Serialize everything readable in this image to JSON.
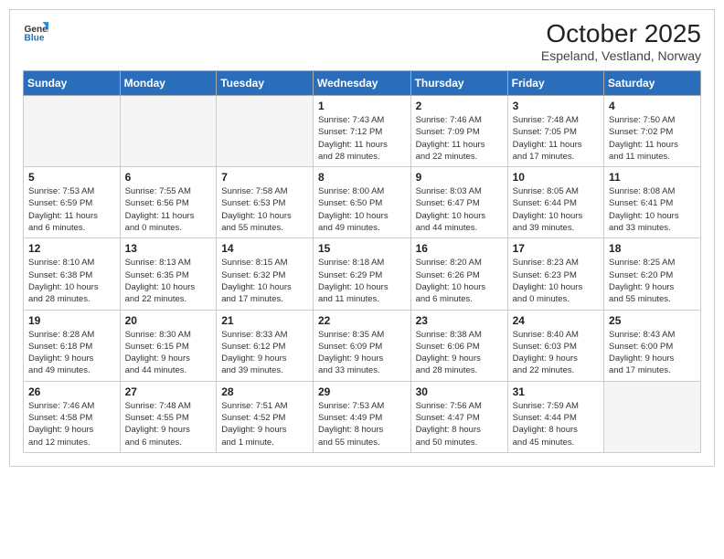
{
  "header": {
    "logo_general": "General",
    "logo_blue": "Blue",
    "title": "October 2025",
    "subtitle": "Espeland, Vestland, Norway"
  },
  "days_of_week": [
    "Sunday",
    "Monday",
    "Tuesday",
    "Wednesday",
    "Thursday",
    "Friday",
    "Saturday"
  ],
  "weeks": [
    [
      {
        "day": "",
        "info": ""
      },
      {
        "day": "",
        "info": ""
      },
      {
        "day": "",
        "info": ""
      },
      {
        "day": "1",
        "info": "Sunrise: 7:43 AM\nSunset: 7:12 PM\nDaylight: 11 hours\nand 28 minutes."
      },
      {
        "day": "2",
        "info": "Sunrise: 7:46 AM\nSunset: 7:09 PM\nDaylight: 11 hours\nand 22 minutes."
      },
      {
        "day": "3",
        "info": "Sunrise: 7:48 AM\nSunset: 7:05 PM\nDaylight: 11 hours\nand 17 minutes."
      },
      {
        "day": "4",
        "info": "Sunrise: 7:50 AM\nSunset: 7:02 PM\nDaylight: 11 hours\nand 11 minutes."
      }
    ],
    [
      {
        "day": "5",
        "info": "Sunrise: 7:53 AM\nSunset: 6:59 PM\nDaylight: 11 hours\nand 6 minutes."
      },
      {
        "day": "6",
        "info": "Sunrise: 7:55 AM\nSunset: 6:56 PM\nDaylight: 11 hours\nand 0 minutes."
      },
      {
        "day": "7",
        "info": "Sunrise: 7:58 AM\nSunset: 6:53 PM\nDaylight: 10 hours\nand 55 minutes."
      },
      {
        "day": "8",
        "info": "Sunrise: 8:00 AM\nSunset: 6:50 PM\nDaylight: 10 hours\nand 49 minutes."
      },
      {
        "day": "9",
        "info": "Sunrise: 8:03 AM\nSunset: 6:47 PM\nDaylight: 10 hours\nand 44 minutes."
      },
      {
        "day": "10",
        "info": "Sunrise: 8:05 AM\nSunset: 6:44 PM\nDaylight: 10 hours\nand 39 minutes."
      },
      {
        "day": "11",
        "info": "Sunrise: 8:08 AM\nSunset: 6:41 PM\nDaylight: 10 hours\nand 33 minutes."
      }
    ],
    [
      {
        "day": "12",
        "info": "Sunrise: 8:10 AM\nSunset: 6:38 PM\nDaylight: 10 hours\nand 28 minutes."
      },
      {
        "day": "13",
        "info": "Sunrise: 8:13 AM\nSunset: 6:35 PM\nDaylight: 10 hours\nand 22 minutes."
      },
      {
        "day": "14",
        "info": "Sunrise: 8:15 AM\nSunset: 6:32 PM\nDaylight: 10 hours\nand 17 minutes."
      },
      {
        "day": "15",
        "info": "Sunrise: 8:18 AM\nSunset: 6:29 PM\nDaylight: 10 hours\nand 11 minutes."
      },
      {
        "day": "16",
        "info": "Sunrise: 8:20 AM\nSunset: 6:26 PM\nDaylight: 10 hours\nand 6 minutes."
      },
      {
        "day": "17",
        "info": "Sunrise: 8:23 AM\nSunset: 6:23 PM\nDaylight: 10 hours\nand 0 minutes."
      },
      {
        "day": "18",
        "info": "Sunrise: 8:25 AM\nSunset: 6:20 PM\nDaylight: 9 hours\nand 55 minutes."
      }
    ],
    [
      {
        "day": "19",
        "info": "Sunrise: 8:28 AM\nSunset: 6:18 PM\nDaylight: 9 hours\nand 49 minutes."
      },
      {
        "day": "20",
        "info": "Sunrise: 8:30 AM\nSunset: 6:15 PM\nDaylight: 9 hours\nand 44 minutes."
      },
      {
        "day": "21",
        "info": "Sunrise: 8:33 AM\nSunset: 6:12 PM\nDaylight: 9 hours\nand 39 minutes."
      },
      {
        "day": "22",
        "info": "Sunrise: 8:35 AM\nSunset: 6:09 PM\nDaylight: 9 hours\nand 33 minutes."
      },
      {
        "day": "23",
        "info": "Sunrise: 8:38 AM\nSunset: 6:06 PM\nDaylight: 9 hours\nand 28 minutes."
      },
      {
        "day": "24",
        "info": "Sunrise: 8:40 AM\nSunset: 6:03 PM\nDaylight: 9 hours\nand 22 minutes."
      },
      {
        "day": "25",
        "info": "Sunrise: 8:43 AM\nSunset: 6:00 PM\nDaylight: 9 hours\nand 17 minutes."
      }
    ],
    [
      {
        "day": "26",
        "info": "Sunrise: 7:46 AM\nSunset: 4:58 PM\nDaylight: 9 hours\nand 12 minutes."
      },
      {
        "day": "27",
        "info": "Sunrise: 7:48 AM\nSunset: 4:55 PM\nDaylight: 9 hours\nand 6 minutes."
      },
      {
        "day": "28",
        "info": "Sunrise: 7:51 AM\nSunset: 4:52 PM\nDaylight: 9 hours\nand 1 minute."
      },
      {
        "day": "29",
        "info": "Sunrise: 7:53 AM\nSunset: 4:49 PM\nDaylight: 8 hours\nand 55 minutes."
      },
      {
        "day": "30",
        "info": "Sunrise: 7:56 AM\nSunset: 4:47 PM\nDaylight: 8 hours\nand 50 minutes."
      },
      {
        "day": "31",
        "info": "Sunrise: 7:59 AM\nSunset: 4:44 PM\nDaylight: 8 hours\nand 45 minutes."
      },
      {
        "day": "",
        "info": ""
      }
    ]
  ]
}
